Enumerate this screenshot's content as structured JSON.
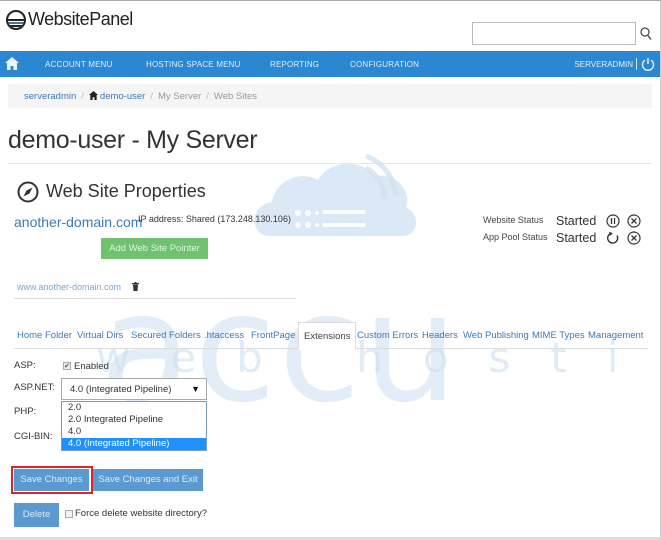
{
  "header": {
    "logo_text": "WebsitePanel",
    "search": {
      "value": "",
      "placeholder": ""
    }
  },
  "nav": {
    "items": [
      {
        "label": "ACCOUNT MENU"
      },
      {
        "label": "HOSTING SPACE MENU"
      },
      {
        "label": "REPORTING"
      },
      {
        "label": "CONFIGURATION"
      }
    ],
    "user": "SERVERADMIN",
    "separator": "|"
  },
  "breadcrumb": {
    "items": [
      {
        "label": "serveradmin",
        "link": true
      },
      {
        "label": "demo-user",
        "link": true,
        "icon": "home-icon"
      },
      {
        "label": "My Server",
        "link": false
      },
      {
        "label": "Web Sites",
        "link": false
      }
    ],
    "separator": "/"
  },
  "page": {
    "title": "demo-user - My Server"
  },
  "section": {
    "icon": "compass-icon",
    "title": "Web Site Properties"
  },
  "site": {
    "domain": "another-domain.com",
    "ip_address": "IP address: Shared (173.248.130.106)",
    "add_pointer_label": "Add Web Site Pointer",
    "pointer": "www.another-domain.com"
  },
  "status": {
    "website_label": "Website Status",
    "website_value": "Started",
    "app_pool_label": "App Pool Status",
    "app_pool_value": "Started"
  },
  "tabs": [
    {
      "label": "Home Folder",
      "active": false
    },
    {
      "label": "Virtual Dirs",
      "active": false
    },
    {
      "label": "Secured Folders",
      "active": false
    },
    {
      "label": ".htaccess",
      "active": false
    },
    {
      "label": "FrontPage",
      "active": false
    },
    {
      "label": "Extensions",
      "active": true
    },
    {
      "label": "Custom Errors",
      "active": false
    },
    {
      "label": "Headers",
      "active": false
    },
    {
      "label": "Web Publishing",
      "active": false
    },
    {
      "label": "MIME Types",
      "active": false
    },
    {
      "label": "Management",
      "active": false
    }
  ],
  "extensions": {
    "asp_label": "ASP:",
    "asp_enabled_label": "Enabled",
    "asp_enabled": true,
    "aspnet_label": "ASP.NET:",
    "aspnet_value": "4.0 (Integrated Pipeline)",
    "aspnet_options": [
      "2.0",
      "2.0 Integrated Pipeline",
      "4.0",
      "4.0 (Integrated Pipeline)"
    ],
    "aspnet_selected_index": 3,
    "php_label": "PHP:",
    "cgibin_label": "CGI-BIN:"
  },
  "actions": {
    "save_label": "Save Changes",
    "save_exit_label": "Save Changes and Exit",
    "delete_label": "Delete",
    "force_delete_label": "Force delete website directory?",
    "force_delete_checked": false
  },
  "watermark": {
    "brand": "accu",
    "tagline": "web hosting"
  },
  "colors": {
    "nav_bg": "#2b87d1",
    "link": "#3b7ab8",
    "green_button": "#6fc36f",
    "blue_button": "#5b9ad0",
    "highlight": "#e0232a",
    "selected_option": "#1e90ff"
  }
}
